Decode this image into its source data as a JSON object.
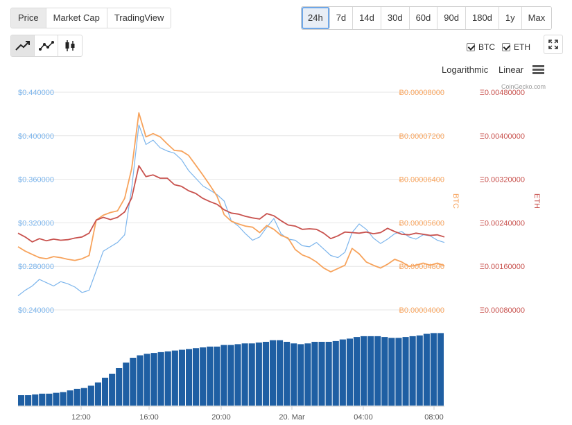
{
  "tabs": [
    "Price",
    "Market Cap",
    "TradingView"
  ],
  "ranges": [
    "24h",
    "7d",
    "14d",
    "30d",
    "60d",
    "90d",
    "180d",
    "1y",
    "Max"
  ],
  "active_tab": "Price",
  "active_range": "24h",
  "chart_type_icons": [
    "line-chart-icon",
    "line-points-chart-icon",
    "candlestick-chart-icon"
  ],
  "toggles": {
    "btc": "BTC",
    "eth": "ETH"
  },
  "scales": {
    "log": "Logarithmic",
    "linear": "Linear"
  },
  "credit": "CoinGecko.com",
  "colors": {
    "usd": "#7cb5ec",
    "btc": "#f7a35c",
    "eth": "#c8514d",
    "volume": "#1f5fa3",
    "grid": "#e6e6e6"
  },
  "chart_data": {
    "type": "line",
    "x_ticks": [
      "12:00",
      "16:00",
      "20:00",
      "20. Mar",
      "04:00",
      "08:00"
    ],
    "axes": {
      "usd": {
        "ticks": [
          "$0.440000",
          "$0.400000",
          "$0.360000",
          "$0.320000",
          "$0.280000",
          "$0.240000"
        ],
        "range": [
          0.24,
          0.44
        ]
      },
      "btc": {
        "label": "BTC",
        "ticks": [
          "Ƀ0.00008000",
          "Ƀ0.00007200",
          "Ƀ0.00006400",
          "Ƀ0.00005600",
          "Ƀ0.00004800",
          "Ƀ0.00004000"
        ],
        "range": [
          4e-05,
          8e-05
        ]
      },
      "eth": {
        "label": "ETH",
        "ticks": [
          "Ξ0.00480000",
          "Ξ0.00400000",
          "Ξ0.00320000",
          "Ξ0.00240000",
          "Ξ0.00160000",
          "Ξ0.00080000"
        ],
        "range": [
          0.0008,
          0.0048
        ]
      }
    },
    "series": [
      {
        "key": "usd",
        "values": [
          0.253,
          0.258,
          0.262,
          0.268,
          0.265,
          0.262,
          0.266,
          0.264,
          0.261,
          0.256,
          0.258,
          0.276,
          0.294,
          0.298,
          0.302,
          0.309,
          0.352,
          0.41,
          0.392,
          0.396,
          0.389,
          0.386,
          0.384,
          0.378,
          0.368,
          0.361,
          0.354,
          0.35,
          0.346,
          0.34,
          0.322,
          0.317,
          0.31,
          0.304,
          0.307,
          0.316,
          0.324,
          0.31,
          0.305,
          0.304,
          0.299,
          0.298,
          0.302,
          0.296,
          0.29,
          0.288,
          0.293,
          0.311,
          0.319,
          0.314,
          0.306,
          0.301,
          0.305,
          0.31,
          0.312,
          0.307,
          0.305,
          0.309,
          0.308,
          0.304,
          0.302
        ]
      },
      {
        "key": "btc",
        "values": [
          5.16e-05,
          5.08e-05,
          5.02e-05,
          4.96e-05,
          4.94e-05,
          4.98e-05,
          4.96e-05,
          4.93e-05,
          4.91e-05,
          4.94e-05,
          5e-05,
          5.65e-05,
          5.74e-05,
          5.79e-05,
          5.82e-05,
          6.05e-05,
          6.6e-05,
          7.62e-05,
          7.18e-05,
          7.24e-05,
          7.18e-05,
          7.05e-05,
          6.93e-05,
          6.92e-05,
          6.84e-05,
          6.66e-05,
          6.48e-05,
          6.29e-05,
          6.09e-05,
          5.75e-05,
          5.63e-05,
          5.58e-05,
          5.54e-05,
          5.52e-05,
          5.42e-05,
          5.55e-05,
          5.48e-05,
          5.37e-05,
          5.32e-05,
          5.11e-05,
          5.01e-05,
          4.96e-05,
          4.88e-05,
          4.77e-05,
          4.7e-05,
          4.76e-05,
          4.82e-05,
          5.13e-05,
          5.03e-05,
          4.88e-05,
          4.82e-05,
          4.77e-05,
          4.84e-05,
          4.93e-05,
          4.88e-05,
          4.8e-05,
          4.82e-05,
          4.86e-05,
          4.82e-05,
          4.86e-05,
          4.81e-05
        ]
      },
      {
        "key": "eth",
        "values": [
          0.00221,
          0.00214,
          0.00205,
          0.00211,
          0.00207,
          0.0021,
          0.00208,
          0.00209,
          0.00212,
          0.00214,
          0.00221,
          0.00245,
          0.0025,
          0.00246,
          0.0025,
          0.0026,
          0.00286,
          0.00345,
          0.00325,
          0.00328,
          0.00322,
          0.00322,
          0.0031,
          0.00307,
          0.00299,
          0.00294,
          0.00285,
          0.00279,
          0.00274,
          0.00264,
          0.00258,
          0.00256,
          0.00252,
          0.00249,
          0.00247,
          0.00257,
          0.00253,
          0.00244,
          0.00236,
          0.00234,
          0.00228,
          0.00229,
          0.00228,
          0.00221,
          0.00211,
          0.00216,
          0.00223,
          0.00222,
          0.00221,
          0.00223,
          0.0022,
          0.00222,
          0.0023,
          0.00224,
          0.00219,
          0.00218,
          0.00221,
          0.00219,
          0.00217,
          0.00218,
          0.00214
        ]
      }
    ],
    "volume_relative": [
      0.13,
      0.13,
      0.14,
      0.15,
      0.15,
      0.16,
      0.17,
      0.19,
      0.21,
      0.22,
      0.25,
      0.29,
      0.35,
      0.4,
      0.47,
      0.54,
      0.6,
      0.63,
      0.65,
      0.66,
      0.67,
      0.68,
      0.69,
      0.7,
      0.71,
      0.72,
      0.73,
      0.74,
      0.74,
      0.76,
      0.76,
      0.77,
      0.78,
      0.78,
      0.79,
      0.8,
      0.82,
      0.82,
      0.8,
      0.78,
      0.77,
      0.78,
      0.8,
      0.8,
      0.8,
      0.81,
      0.83,
      0.84,
      0.86,
      0.87,
      0.87,
      0.87,
      0.86,
      0.85,
      0.85,
      0.86,
      0.87,
      0.88,
      0.9,
      0.91,
      0.91
    ]
  }
}
